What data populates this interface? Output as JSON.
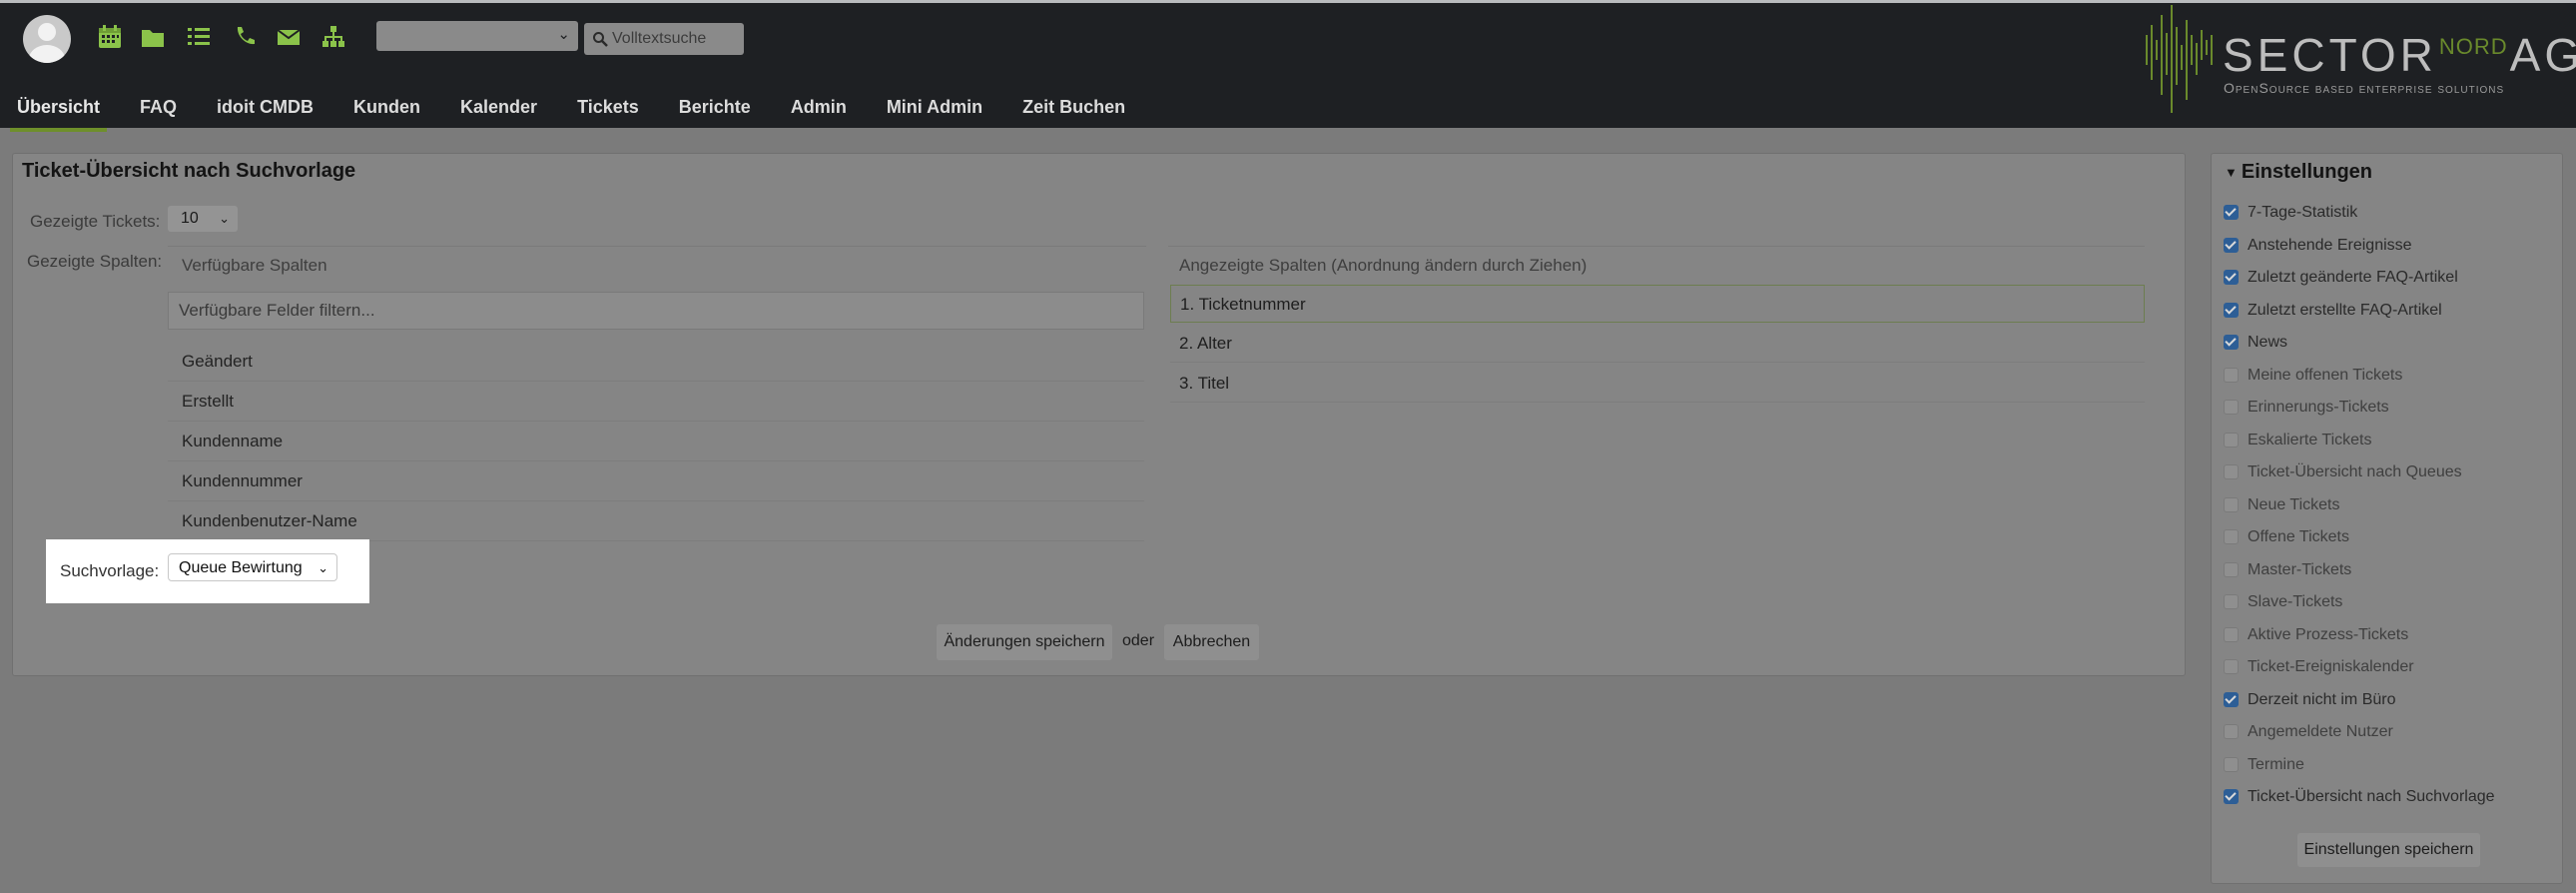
{
  "header": {
    "fulltext_placeholder": "Volltextsuche",
    "nav": [
      "Übersicht",
      "FAQ",
      "idoit CMDB",
      "Kunden",
      "Kalender",
      "Tickets",
      "Berichte",
      "Admin",
      "Mini Admin",
      "Zeit Buchen"
    ],
    "active_nav": "Übersicht",
    "logo": {
      "word_start": "SECTOR",
      "word_nord": "NORD",
      "word_end": "AG",
      "tagline": "OpenSource based enterprise solutions"
    },
    "icons": [
      "calendar-icon",
      "folder-icon",
      "list-icon",
      "phone-icon",
      "envelope-icon",
      "sitemap-icon"
    ],
    "colors": {
      "accent": "#8bc34a",
      "header_bg": "#1e2023"
    }
  },
  "main": {
    "title": "Ticket-Übersicht nach Suchvorlage",
    "shown_tickets_label": "Gezeigte Tickets:",
    "shown_tickets_value": "10",
    "shown_columns_label": "Gezeigte Spalten:",
    "available_header": "Verfügbare Spalten",
    "filter_placeholder": "Verfügbare Felder filtern...",
    "available": [
      "Geändert",
      "Erstellt",
      "Kundenname",
      "Kundennummer",
      "Kundenbenutzer-Name"
    ],
    "shown_header": "Angezeigte Spalten (Anordnung ändern durch Ziehen)",
    "shown": [
      "1. Ticketnummer",
      "2. Alter",
      "3. Titel"
    ],
    "search_template_label": "Suchvorlage:",
    "search_template_value": "Queue Bewirtung",
    "save_label": "Änderungen speichern",
    "or_label": "oder",
    "cancel_label": "Abbrechen"
  },
  "sidebar": {
    "title": "Einstellungen",
    "items": [
      {
        "label": "7-Tage-Statistik",
        "checked": true
      },
      {
        "label": "Anstehende Ereignisse",
        "checked": true
      },
      {
        "label": "Zuletzt geänderte FAQ-Artikel",
        "checked": true
      },
      {
        "label": "Zuletzt erstellte FAQ-Artikel",
        "checked": true
      },
      {
        "label": "News",
        "checked": true
      },
      {
        "label": "Meine offenen Tickets",
        "checked": false
      },
      {
        "label": "Erinnerungs-Tickets",
        "checked": false
      },
      {
        "label": "Eskalierte Tickets",
        "checked": false
      },
      {
        "label": "Ticket-Übersicht nach Queues",
        "checked": false
      },
      {
        "label": "Neue Tickets",
        "checked": false
      },
      {
        "label": "Offene Tickets",
        "checked": false
      },
      {
        "label": "Master-Tickets",
        "checked": false
      },
      {
        "label": "Slave-Tickets",
        "checked": false
      },
      {
        "label": "Aktive Prozess-Tickets",
        "checked": false
      },
      {
        "label": "Ticket-Ereigniskalender",
        "checked": false
      },
      {
        "label": "Derzeit nicht im Büro",
        "checked": true
      },
      {
        "label": "Angemeldete Nutzer",
        "checked": false
      },
      {
        "label": "Termine",
        "checked": false
      },
      {
        "label": "Ticket-Übersicht nach Suchvorlage",
        "checked": true
      }
    ],
    "save_label": "Einstellungen speichern"
  }
}
